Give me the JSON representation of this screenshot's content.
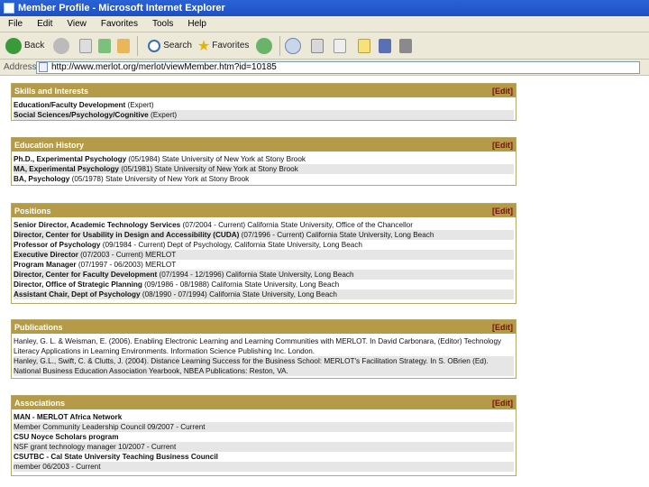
{
  "window": {
    "title": "Member Profile - Microsoft Internet Explorer"
  },
  "menu": [
    "File",
    "Edit",
    "View",
    "Favorites",
    "Tools",
    "Help"
  ],
  "toolbar": {
    "back_label": "Back",
    "search_label": "Search",
    "favorites_label": "Favorites"
  },
  "address": {
    "label": "Address",
    "url": "http://www.merlot.org/merlot/viewMember.htm?id=10185"
  },
  "sections": {
    "skills": {
      "title": "Skills and Interests",
      "edit": "[Edit]",
      "rows": [
        {
          "bold": "Education/Faculty Development",
          "rest": " (Expert)"
        },
        {
          "bold": "Social Sciences/Psychology/Cognitive",
          "rest": " (Expert)"
        }
      ]
    },
    "education": {
      "title": "Education History",
      "edit": "[Edit]",
      "rows": [
        {
          "bold": "Ph.D., Experimental Psychology",
          "rest": " (05/1984) State University of New York at Stony Brook"
        },
        {
          "bold": "MA, Experimental Psychology",
          "rest": " (05/1981) State University of New York at Stony Brook"
        },
        {
          "bold": "BA, Psychology",
          "rest": " (05/1978) State University of New York at Stony Brook"
        }
      ]
    },
    "positions": {
      "title": "Positions",
      "edit": "[Edit]",
      "rows": [
        {
          "bold": "Senior Director, Academic Technology Services",
          "rest": " (07/2004 - Current) California State University, Office of the Chancellor"
        },
        {
          "bold": "Director, Center for Usability in Design and Accessibility (CUDA)",
          "rest": " (07/1996 - Current) California State University, Long Beach"
        },
        {
          "bold": "Professor of Psychology",
          "rest": " (09/1984 - Current) Dept of Psychology, California State University, Long Beach"
        },
        {
          "bold": "Executive Director",
          "rest": " (07/2003 - Current) MERLOT"
        },
        {
          "bold": "Program Manager",
          "rest": " (07/1997 - 06/2003) MERLOT"
        },
        {
          "bold": "Director, Center for Faculty Development",
          "rest": " (07/1994 - 12/1996) California State University, Long Beach"
        },
        {
          "bold": "Director, Office of Strategic Planning",
          "rest": " (09/1986 - 08/1988) California State University, Long Beach"
        },
        {
          "bold": "Assistant Chair, Dept of Psychology",
          "rest": " (08/1990 - 07/1994) California State University, Long Beach"
        }
      ]
    },
    "publications": {
      "title": "Publications",
      "edit": "[Edit]",
      "rows": [
        {
          "text": "Hanley, G. L. & Weisman, E. (2006). Enabling Electronic Learning and Learning Communities with MERLOT. In David Carbonara, (Editor) Technology Literacy Applications in Learning Environments. Information Science Publishing Inc. London."
        },
        {
          "text": "Hanley, G.L., Swift, C. & Clutts, J. (2004). Distance Learning Success for the Business School: MERLOT's Facilitation Strategy. In S. OBrien (Ed). National Business Education Association Yearbook, NBEA Publications: Reston, VA."
        }
      ]
    },
    "associations": {
      "title": "Associations",
      "edit": "[Edit]",
      "rows": [
        {
          "bold": "MAN - MERLOT Africa Network",
          "rest": ""
        },
        {
          "bold": "",
          "rest": "Member Community Leadership Council 09/2007 - Current"
        },
        {
          "bold": "CSU Noyce Scholars program",
          "rest": ""
        },
        {
          "bold": "",
          "rest": "NSF grant technology manager 10/2007 - Current"
        },
        {
          "bold": "CSUTBC - Cal State University Teaching Business Council",
          "rest": ""
        },
        {
          "bold": "",
          "rest": "member 06/2003 - Current"
        }
      ]
    }
  }
}
